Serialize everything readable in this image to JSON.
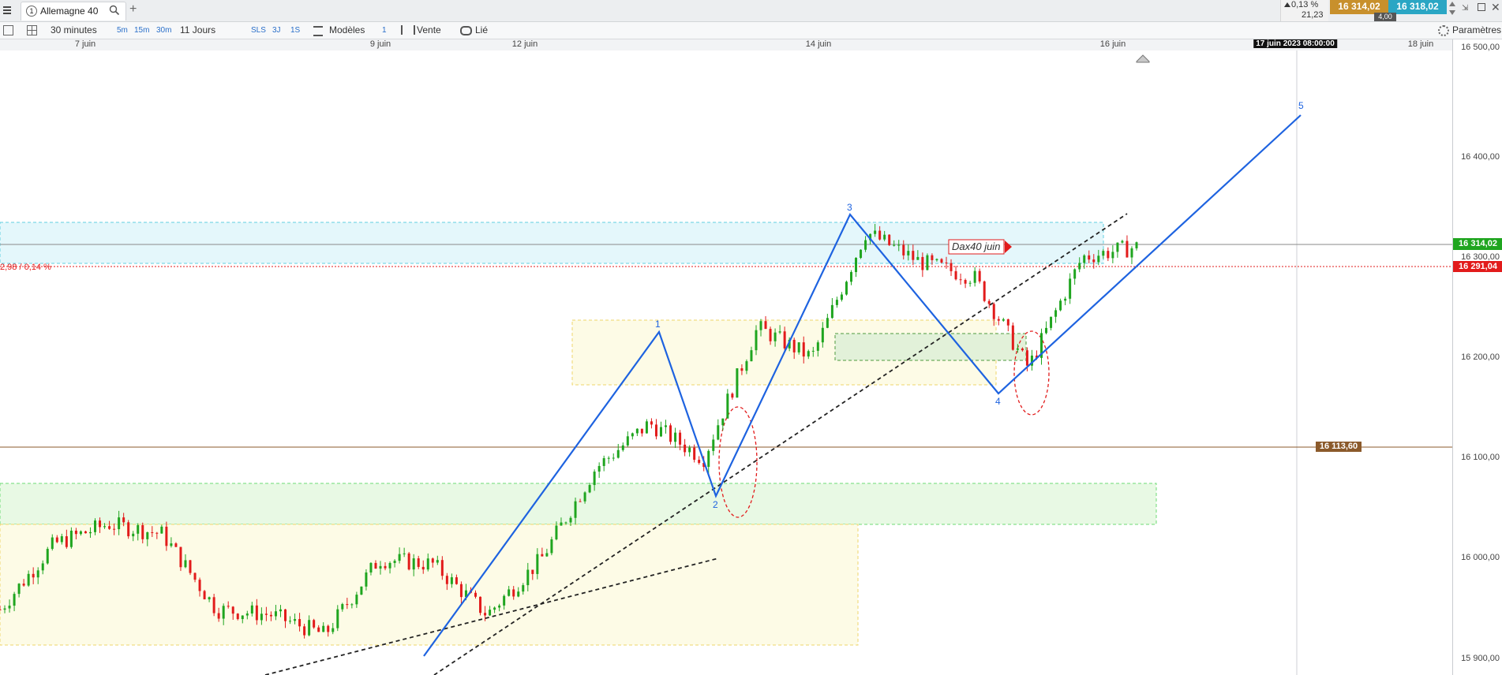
{
  "window": {
    "menu_icon": "hamburger-icon",
    "tab_number": "1",
    "tab_title": "Allemagne 40",
    "add_tab_icon": "plus-icon"
  },
  "quote": {
    "change_pct": "0,13 %",
    "change_pts": "21,23",
    "bid": "16 314,02",
    "ask": "16 318,02",
    "spread": "4,00",
    "bid_color": "#c8902c",
    "ask_color": "#2aa6c4"
  },
  "toolbar": {
    "timeframe": "30 minutes",
    "tf_5m": "5m",
    "tf_15m": "15m",
    "tf_30m": "30m",
    "period": "11 Jours",
    "sls": "SLS",
    "tf_3j": "3J",
    "tf_1s": "1S",
    "models": "Modèles",
    "count": "1",
    "sell": "Vente",
    "linked": "Lié",
    "settings": "Paramètres"
  },
  "date_axis": {
    "labels": [
      "7 juin",
      "9 juin",
      "12 juin",
      "14 juin",
      "16 juin",
      "18 juin"
    ],
    "cursor_label": "17 juin 2023 08:00:00"
  },
  "price_axis": {
    "labels": [
      "16 500,00",
      "16 400,00",
      "16 300,00",
      "16 200,00",
      "16 100,00",
      "16 000,00",
      "15 900,00"
    ],
    "current_price": "16 314,02",
    "current_color": "#1fa51f",
    "red_level": "16 291,04",
    "red_color": "#e21b1b",
    "brown_level": "16 113,60",
    "brown_color": "#8b5a2b"
  },
  "annotations": {
    "change_text": "2,98 / 0,14 %",
    "dax_label": "Dax40 juin",
    "wave_labels": [
      "1",
      "2",
      "3",
      "4",
      "5"
    ]
  },
  "chart_data": {
    "type": "candlestick",
    "instrument": "Allemagne 40",
    "interval": "30 minutes",
    "y_range": [
      15890,
      16510
    ],
    "x_ticks": [
      "7 juin",
      "9 juin",
      "12 juin",
      "14 juin",
      "16 juin",
      "18 juin"
    ],
    "price_levels": {
      "last": 16314.02,
      "red_line": 16291.04,
      "brown_line": 16113.6
    },
    "elliott_waves": [
      {
        "label": "1",
        "price": 16222
      },
      {
        "label": "2",
        "price": 16070
      },
      {
        "label": "3",
        "price": 16340
      },
      {
        "label": "4",
        "price": 16162
      },
      {
        "label": "5",
        "price": 16465
      }
    ],
    "close_path": [
      {
        "date": "7 juin 00:00",
        "close": 15955
      },
      {
        "date": "7 juin 08:00",
        "close": 16020
      },
      {
        "date": "7 juin 16:00",
        "close": 16040
      },
      {
        "date": "8 juin 00:00",
        "close": 16030
      },
      {
        "date": "8 juin 08:00",
        "close": 15955
      },
      {
        "date": "8 juin 16:00",
        "close": 15950
      },
      {
        "date": "9 juin 00:00",
        "close": 15930
      },
      {
        "date": "9 juin 08:00",
        "close": 16005
      },
      {
        "date": "9 juin 16:00",
        "close": 16000
      },
      {
        "date": "12 juin 00:00",
        "close": 15950
      },
      {
        "date": "12 juin 08:00",
        "close": 16005
      },
      {
        "date": "12 juin 16:00",
        "close": 16095
      },
      {
        "date": "13 juin 00:00",
        "close": 16140
      },
      {
        "date": "13 juin 08:00",
        "close": 16105
      },
      {
        "date": "13 juin 16:00",
        "close": 16235
      },
      {
        "date": "14 juin 00:00",
        "close": 16205
      },
      {
        "date": "14 juin 08:00",
        "close": 16330
      },
      {
        "date": "14 juin 16:00",
        "close": 16300
      },
      {
        "date": "15 juin 00:00",
        "close": 16285
      },
      {
        "date": "15 juin 08:00",
        "close": 16195
      },
      {
        "date": "15 juin 16:00",
        "close": 16305
      },
      {
        "date": "16 juin 00:00",
        "close": 16315
      }
    ]
  }
}
